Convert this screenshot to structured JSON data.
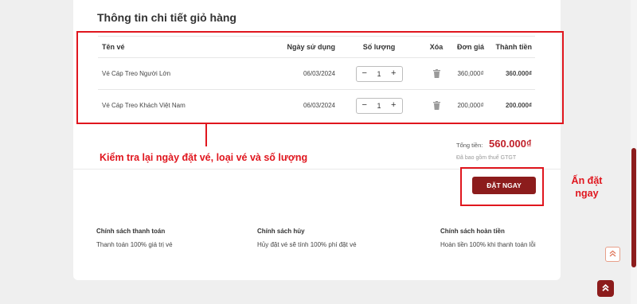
{
  "cart": {
    "title": "Thông tin chi tiết giỏ hàng",
    "columns": {
      "name": "Tên vé",
      "date": "Ngày sử dụng",
      "qty": "Số lượng",
      "delete": "Xóa",
      "unit_price": "Đơn giá",
      "total": "Thành tiền"
    },
    "items": [
      {
        "name": "Vé Cáp Treo Người Lớn",
        "date": "06/03/2024",
        "minus": "−",
        "qty": "1",
        "plus": "+",
        "unit_price": "360,000₫",
        "total": "360.000₫"
      },
      {
        "name": "Vé Cáp Treo Khách Việt Nam",
        "date": "06/03/2024",
        "minus": "−",
        "qty": "1",
        "plus": "+",
        "unit_price": "200,000₫",
        "total": "200.000₫"
      }
    ]
  },
  "summary": {
    "label": "Tổng tiền:",
    "value": "560.000₫",
    "note": "Đã bao gồm thuế GTGT"
  },
  "order_button": "ĐẶT NGAY",
  "annotations": {
    "check": "Kiểm tra lại ngày đặt vé, loại vé và số lượng",
    "order": "Ấn đặt ngay"
  },
  "policies": [
    {
      "title": "Chính sách thanh toán",
      "text": "Thanh toán 100% giá trị vé"
    },
    {
      "title": "Chính sách hủy",
      "text": "Hủy đặt vé sẽ tính 100% phí đặt vé"
    },
    {
      "title": "Chính sách hoàn tiền",
      "text": "Hoàn tiền 100% khi thanh toán lỗi"
    }
  ],
  "colors": {
    "brand": "#8c1c1c",
    "price": "#c0212a",
    "annotation": "#e0161e"
  },
  "icons": {
    "delete": "trash-icon",
    "scroll_up": "chevron-up-icon",
    "back_to_top": "double-chevron-up-icon"
  }
}
